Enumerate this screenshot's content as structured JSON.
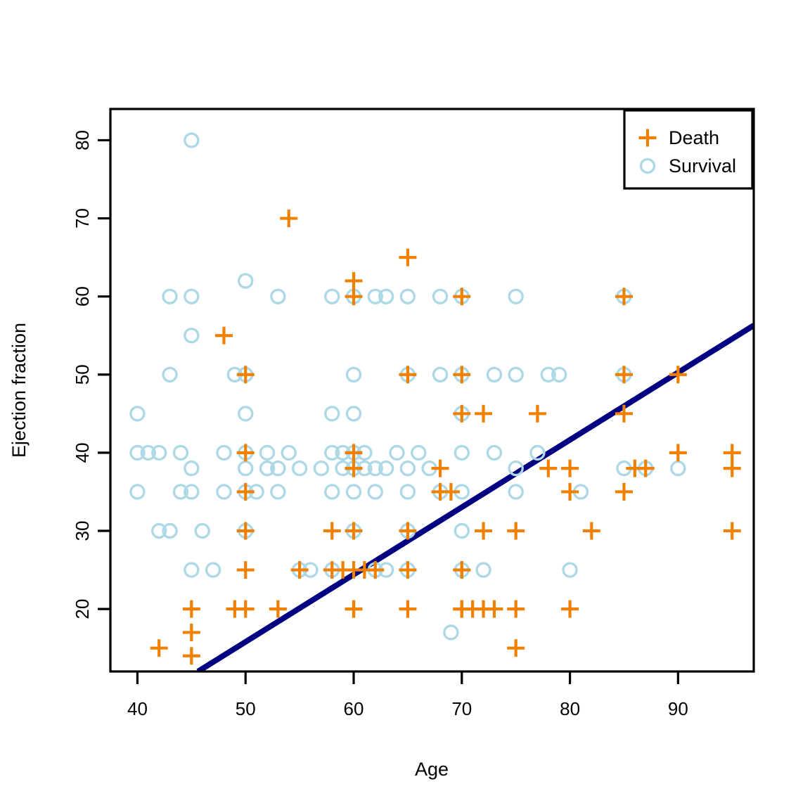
{
  "figure": {
    "title": "",
    "background_color": "#ffffff"
  },
  "axes": {
    "x_label": "Age",
    "y_label": "Ejection fraction",
    "x_ticks": [
      "40",
      "50",
      "60",
      "70",
      "80",
      "90"
    ],
    "y_ticks": [
      "20",
      "30",
      "40",
      "50",
      "60",
      "70",
      "80"
    ]
  },
  "legend": {
    "entries": [
      {
        "label": "Death",
        "marker": "plus-icon",
        "color": "#F08000"
      },
      {
        "label": "Survival",
        "marker": "circle-icon",
        "color": "#ADD8E6"
      }
    ]
  },
  "chart_data": {
    "type": "scatter",
    "title": "",
    "xlabel": "Age",
    "ylabel": "Ejection fraction",
    "xlim": [
      37.5,
      97.0
    ],
    "ylim": [
      12.0,
      84.0
    ],
    "x_ticks": [
      40,
      50,
      60,
      70,
      80,
      90
    ],
    "y_ticks": [
      20,
      30,
      40,
      50,
      60,
      70,
      80
    ],
    "grid": false,
    "legend_position": "top-right",
    "series": [
      {
        "name": "Death",
        "marker": "plus",
        "color": "#F08000",
        "points": [
          [
            42,
            15
          ],
          [
            45,
            14
          ],
          [
            45,
            17
          ],
          [
            45,
            20
          ],
          [
            48,
            55
          ],
          [
            49,
            20
          ],
          [
            50,
            20
          ],
          [
            50,
            30
          ],
          [
            50,
            35
          ],
          [
            50,
            40
          ],
          [
            50,
            50
          ],
          [
            50,
            25
          ],
          [
            53,
            20
          ],
          [
            54,
            70
          ],
          [
            55,
            25
          ],
          [
            58,
            30
          ],
          [
            58,
            25
          ],
          [
            59,
            25
          ],
          [
            60,
            20
          ],
          [
            60,
            20
          ],
          [
            60,
            25
          ],
          [
            60,
            30
          ],
          [
            60,
            38
          ],
          [
            60,
            40
          ],
          [
            60,
            62
          ],
          [
            60,
            60
          ],
          [
            61,
            25
          ],
          [
            62,
            25
          ],
          [
            65,
            20
          ],
          [
            65,
            25
          ],
          [
            65,
            50
          ],
          [
            65,
            65
          ],
          [
            65,
            30
          ],
          [
            68,
            35
          ],
          [
            68,
            38
          ],
          [
            69,
            35
          ],
          [
            70,
            20
          ],
          [
            70,
            20
          ],
          [
            70,
            25
          ],
          [
            70,
            25
          ],
          [
            70,
            45
          ],
          [
            70,
            50
          ],
          [
            70,
            60
          ],
          [
            71,
            20
          ],
          [
            72,
            20
          ],
          [
            72,
            30
          ],
          [
            72,
            45
          ],
          [
            73,
            20
          ],
          [
            75,
            15
          ],
          [
            75,
            20
          ],
          [
            75,
            30
          ],
          [
            77,
            45
          ],
          [
            78,
            38
          ],
          [
            80,
            20
          ],
          [
            80,
            35
          ],
          [
            80,
            38
          ],
          [
            82,
            30
          ],
          [
            85,
            35
          ],
          [
            85,
            45
          ],
          [
            85,
            50
          ],
          [
            85,
            60
          ],
          [
            86,
            38
          ],
          [
            87,
            38
          ],
          [
            90,
            40
          ],
          [
            90,
            50
          ],
          [
            95,
            30
          ],
          [
            95,
            38
          ],
          [
            95,
            40
          ]
        ]
      },
      {
        "name": "Survival",
        "marker": "circle",
        "color": "#ADD8E6",
        "points": [
          [
            40,
            35
          ],
          [
            40,
            40
          ],
          [
            40,
            45
          ],
          [
            41,
            40
          ],
          [
            42,
            40
          ],
          [
            42,
            30
          ],
          [
            43,
            30
          ],
          [
            43,
            50
          ],
          [
            43,
            60
          ],
          [
            44,
            35
          ],
          [
            44,
            40
          ],
          [
            45,
            25
          ],
          [
            45,
            35
          ],
          [
            45,
            38
          ],
          [
            45,
            55
          ],
          [
            45,
            60
          ],
          [
            45,
            80
          ],
          [
            46,
            30
          ],
          [
            47,
            25
          ],
          [
            48,
            40
          ],
          [
            48,
            35
          ],
          [
            49,
            50
          ],
          [
            50,
            30
          ],
          [
            50,
            35
          ],
          [
            50,
            38
          ],
          [
            50,
            40
          ],
          [
            50,
            45
          ],
          [
            50,
            50
          ],
          [
            50,
            62
          ],
          [
            51,
            35
          ],
          [
            52,
            40
          ],
          [
            52,
            38
          ],
          [
            53,
            35
          ],
          [
            53,
            60
          ],
          [
            53,
            38
          ],
          [
            54,
            40
          ],
          [
            55,
            38
          ],
          [
            55,
            25
          ],
          [
            56,
            25
          ],
          [
            57,
            38
          ],
          [
            58,
            25
          ],
          [
            58,
            35
          ],
          [
            58,
            40
          ],
          [
            58,
            45
          ],
          [
            58,
            60
          ],
          [
            59,
            38
          ],
          [
            59,
            40
          ],
          [
            60,
            30
          ],
          [
            60,
            35
          ],
          [
            60,
            38
          ],
          [
            60,
            40
          ],
          [
            60,
            45
          ],
          [
            60,
            50
          ],
          [
            60,
            60
          ],
          [
            61,
            38
          ],
          [
            61,
            40
          ],
          [
            62,
            25
          ],
          [
            62,
            35
          ],
          [
            62,
            38
          ],
          [
            62,
            60
          ],
          [
            63,
            25
          ],
          [
            63,
            60
          ],
          [
            63,
            38
          ],
          [
            64,
            40
          ],
          [
            65,
            25
          ],
          [
            65,
            30
          ],
          [
            65,
            35
          ],
          [
            65,
            38
          ],
          [
            65,
            50
          ],
          [
            65,
            60
          ],
          [
            66,
            40
          ],
          [
            67,
            38
          ],
          [
            68,
            35
          ],
          [
            68,
            50
          ],
          [
            68,
            60
          ],
          [
            69,
            17
          ],
          [
            70,
            25
          ],
          [
            70,
            30
          ],
          [
            70,
            35
          ],
          [
            70,
            40
          ],
          [
            70,
            45
          ],
          [
            70,
            50
          ],
          [
            70,
            60
          ],
          [
            72,
            25
          ],
          [
            73,
            40
          ],
          [
            73,
            50
          ],
          [
            75,
            35
          ],
          [
            75,
            38
          ],
          [
            75,
            50
          ],
          [
            75,
            60
          ],
          [
            77,
            40
          ],
          [
            78,
            50
          ],
          [
            79,
            50
          ],
          [
            80,
            25
          ],
          [
            81,
            35
          ],
          [
            85,
            38
          ],
          [
            85,
            50
          ],
          [
            85,
            60
          ],
          [
            87,
            38
          ],
          [
            90,
            38
          ]
        ]
      }
    ],
    "trend_line": {
      "name": "fitted line",
      "color": "#000080",
      "x_start": 45.6,
      "y_start": 12.0,
      "x_end": 97.0,
      "y_end": 56.3
    }
  }
}
